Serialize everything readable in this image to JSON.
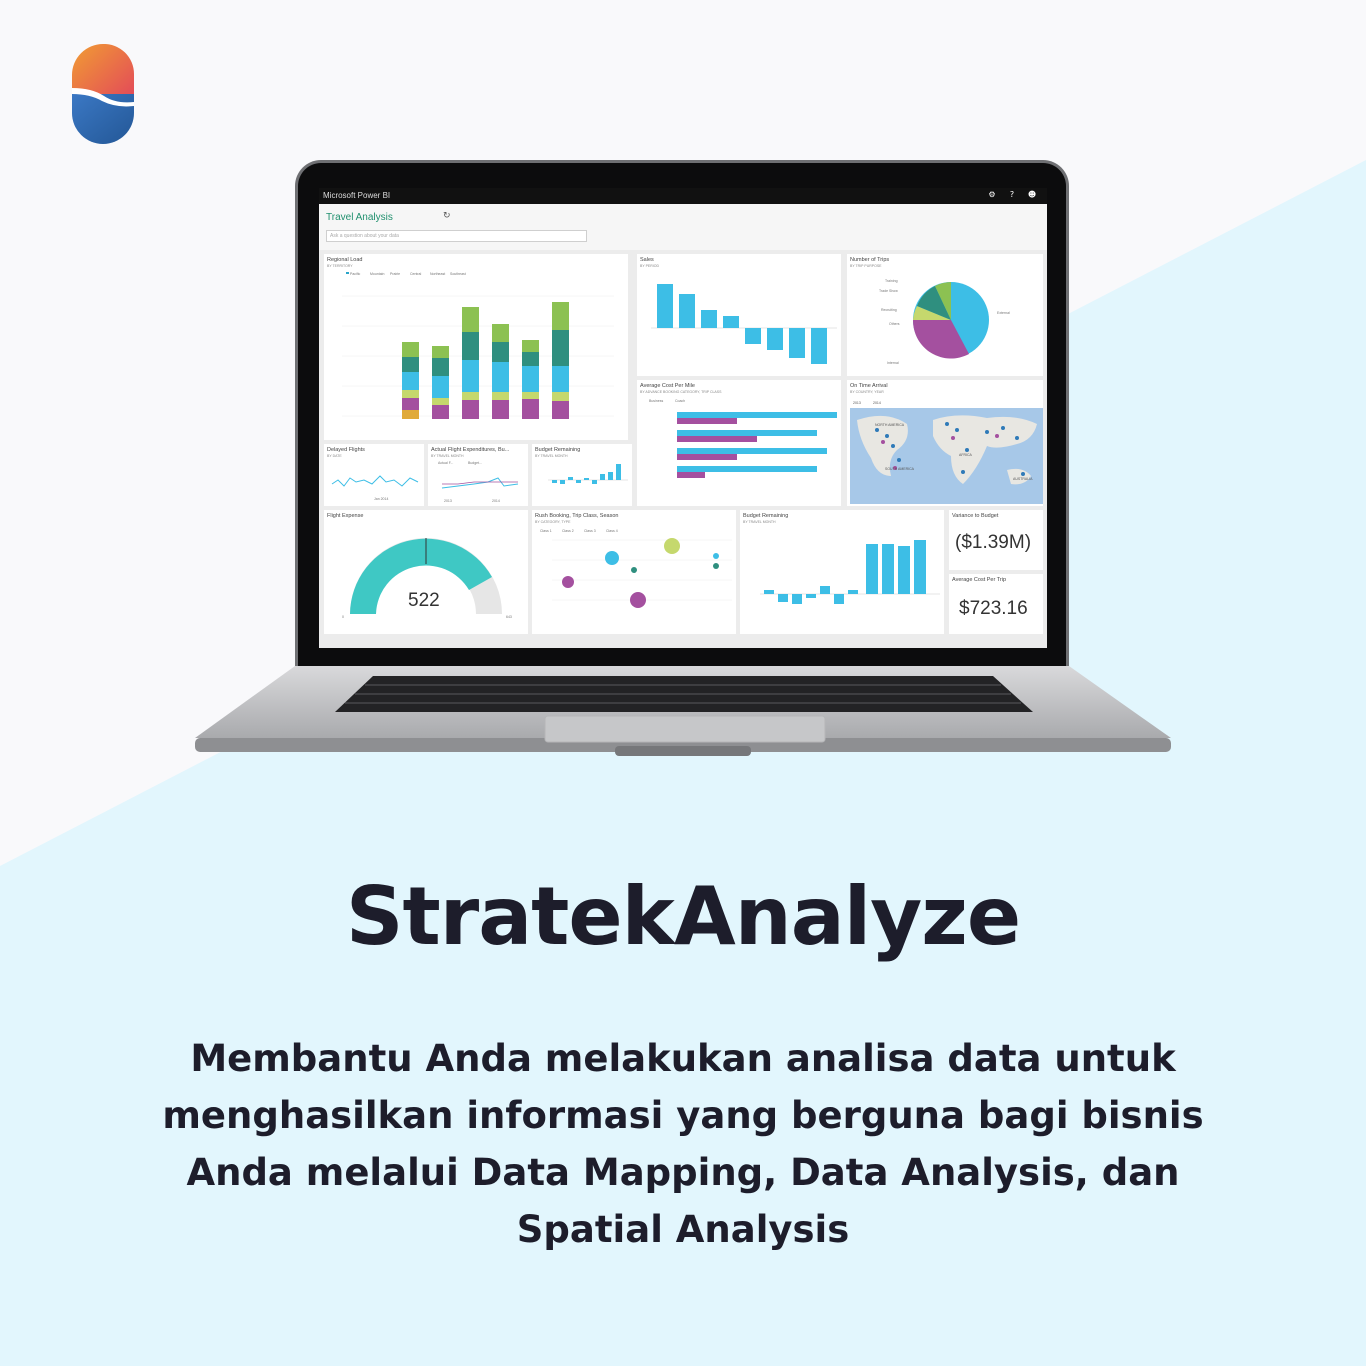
{
  "colors": {
    "background": "#f9f9fb",
    "diagonal": "#e2f6fd",
    "text": "#1d1d2b",
    "logo_gradient": [
      "#f19d33",
      "#e2455b",
      "#3b78c4",
      "#235796"
    ],
    "pbi_teal": "#3dbee6",
    "pbi_accent": "#20906e"
  },
  "logo": {
    "icon": "stratek-s-logo"
  },
  "headline": "StratekAnalyze",
  "description": "Membantu Anda melakukan analisa data untuk menghasilkan informasi yang berguna bagi bisnis Anda melalui Data Mapping, Data Analysis, dan Spatial Analysis",
  "dashboard": {
    "app_name": "Microsoft Power BI",
    "report_title": "Travel Analysis",
    "qa_placeholder": "Ask a question about your data",
    "toolbar_icons": [
      "gear-icon",
      "help-icon",
      "smiley-icon"
    ],
    "tiles": {
      "regional_load": {
        "title": "Regional Load",
        "subtitle": "BY TERRITORY",
        "legend": [
          "Pacific",
          "Mountain",
          "Prairie",
          "Central",
          "Northeast",
          "Southeast"
        ]
      },
      "sales": {
        "title": "Sales",
        "subtitle": "BY PERIOD"
      },
      "trips": {
        "title": "Number of Trips",
        "subtitle": "BY TRIP PURPOSE",
        "labels": [
          "Training",
          "Trade Show",
          "Recruiting",
          "Others",
          "Internal",
          "External"
        ]
      },
      "avg_cost": {
        "title": "Average Cost Per Mile",
        "subtitle": "BY ADVANCE BOOKING CATEGORY, TRIP CLASS",
        "legend": [
          "Business",
          "Coach"
        ]
      },
      "on_time": {
        "title": "On Time Arrival",
        "subtitle": "BY COUNTRY, YEAR",
        "legend": [
          "2013",
          "2014"
        ],
        "map_labels": [
          "NORTH AMERICA",
          "AFRICA",
          "SOUTH AMERICA",
          "AUSTRALIA"
        ]
      },
      "delayed": {
        "title": "Delayed Flights",
        "subtitle": "BY DATE",
        "tick": "Jan 2014"
      },
      "expenditure": {
        "title": "Actual Flight Expenditures, Bu...",
        "subtitle": "BY TRAVEL MONTH",
        "legend": [
          "Actual F...",
          "Budget..."
        ],
        "ticks": [
          "2013",
          "2014"
        ]
      },
      "budget_small": {
        "title": "Budget Remaining",
        "subtitle": "BY TRAVEL MONTH"
      },
      "flight_expense": {
        "title": "Flight Expense",
        "value": "522",
        "min": "0",
        "max": "643"
      },
      "rush": {
        "title": "Rush Booking, Trip Class, Season",
        "subtitle": "BY CATEGORY, TYPE",
        "legend": [
          "Class 1",
          "Class 2",
          "Class 3",
          "Class 4"
        ]
      },
      "budget_large": {
        "title": "Budget Remaining",
        "subtitle": "BY TRAVEL MONTH"
      },
      "variance": {
        "title": "Variance to Budget",
        "value": "($1.39M)"
      },
      "avg_trip": {
        "title": "Average Cost Per Trip",
        "value": "$723.16"
      }
    }
  }
}
